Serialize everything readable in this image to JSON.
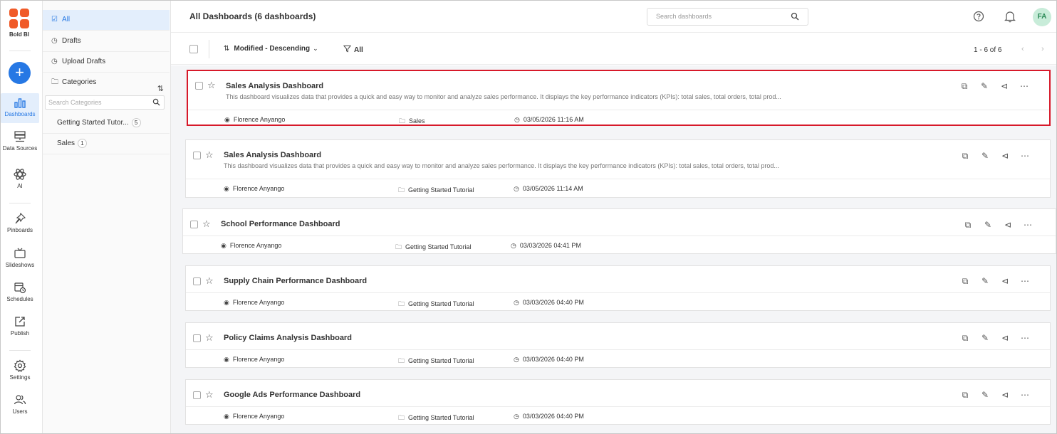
{
  "rail": {
    "logo_text": "Bold BI",
    "add_label": "+",
    "items": [
      {
        "label": "Dashboards",
        "icon": "dashboards-icon"
      },
      {
        "label": "Data Sources",
        "icon": "data-sources-icon"
      },
      {
        "label": "AI",
        "icon": "ai-icon"
      },
      {
        "label": "Pinboards",
        "icon": "pin-icon"
      },
      {
        "label": "Slideshows",
        "icon": "slideshow-icon"
      },
      {
        "label": "Schedules",
        "icon": "schedule-icon"
      },
      {
        "label": "Publish",
        "icon": "publish-icon"
      },
      {
        "label": "Settings",
        "icon": "gear-icon"
      },
      {
        "label": "Users",
        "icon": "users-icon"
      }
    ]
  },
  "panel": {
    "items": [
      {
        "label": "All",
        "icon": "check-square-icon"
      },
      {
        "label": "Drafts",
        "icon": "clock-icon"
      },
      {
        "label": "Upload Drafts",
        "icon": "clock-icon"
      },
      {
        "label": "Categories",
        "icon": "folder-icon"
      }
    ],
    "search_placeholder": "Search Categories",
    "categories": [
      {
        "name": "Getting Started Tutor...",
        "count": "5"
      },
      {
        "name": "Sales",
        "count": "1"
      }
    ]
  },
  "header": {
    "title": "All Dashboards (6 dashboards)",
    "search_placeholder": "Search dashboards",
    "avatar_initials": "FA"
  },
  "toolbar": {
    "sort_label": "Modified - Descending",
    "filter_label": "All",
    "paging_text": "1 - 6 of 6"
  },
  "dashboards": [
    {
      "title": "Sales Analysis Dashboard",
      "description": "This dashboard visualizes data that provides a quick and easy way to monitor and analyze sales performance. It displays the key performance indicators (KPIs): total sales, total orders, total prod...",
      "owner": "Florence Anyango",
      "category": "Sales",
      "modified": "03/05/2026 11:16 AM"
    },
    {
      "title": "Sales Analysis Dashboard",
      "description": "This dashboard visualizes data that provides a quick and easy way to monitor and analyze sales performance. It displays the key performance indicators (KPIs): total sales, total orders, total prod...",
      "owner": "Florence Anyango",
      "category": "Getting Started Tutorial",
      "modified": "03/05/2026 11:14 AM"
    },
    {
      "title": "School Performance Dashboard",
      "owner": "Florence Anyango",
      "category": "Getting Started Tutorial",
      "modified": "03/03/2026 04:41 PM"
    },
    {
      "title": "Supply Chain Performance Dashboard",
      "owner": "Florence Anyango",
      "category": "Getting Started Tutorial",
      "modified": "03/03/2026 04:40 PM"
    },
    {
      "title": "Policy Claims Analysis Dashboard",
      "owner": "Florence Anyango",
      "category": "Getting Started Tutorial",
      "modified": "03/03/2026 04:40 PM"
    },
    {
      "title": "Google Ads Performance Dashboard",
      "owner": "Florence Anyango",
      "category": "Getting Started Tutorial",
      "modified": "03/03/2026 04:40 PM"
    }
  ],
  "colors": {
    "accent": "#2678e4",
    "highlight": "#d7192a",
    "logo": "#f05a28"
  }
}
